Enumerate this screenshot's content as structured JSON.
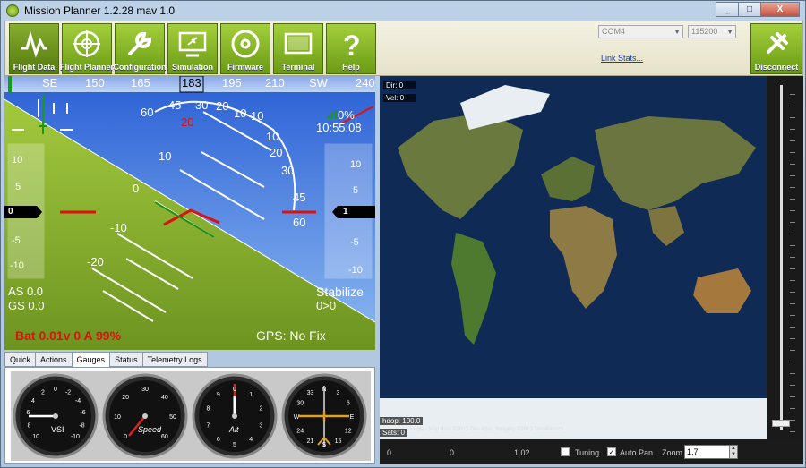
{
  "window": {
    "title": "Mission Planner 1.2.28 mav 1.0",
    "min": "_",
    "max": "□",
    "close": "X"
  },
  "nav": [
    {
      "label": "Flight Data",
      "icon": "pulse-icon"
    },
    {
      "label": "Flight Planner",
      "icon": "globe-icon"
    },
    {
      "label": "Configuration",
      "icon": "wrench-icon"
    },
    {
      "label": "Simulation",
      "icon": "monitor-plane-icon"
    },
    {
      "label": "Firmware",
      "icon": "disc-icon"
    },
    {
      "label": "Terminal",
      "icon": "terminal-icon"
    },
    {
      "label": "Help",
      "icon": "question-icon"
    }
  ],
  "connection": {
    "port": "COM4",
    "baud": "115200",
    "link_stats": "Link Stats...",
    "disconnect_label": "Disconnect"
  },
  "hud": {
    "heading_labels": [
      "SE",
      "150",
      "165",
      "183",
      "195",
      "210",
      "SW",
      "240"
    ],
    "airspeed": "AS 0.0",
    "groundspeed": "GS 0.0",
    "speed_readout": "0",
    "alt_readout": "1",
    "speed_ticks": [
      "10",
      "5",
      "0",
      "-5",
      "-10"
    ],
    "alt_ticks": [
      "10",
      "5",
      "0",
      "-5",
      "-10"
    ],
    "roll_labels_left": [
      "60",
      "45",
      "30",
      "20"
    ],
    "roll_labels_right": [
      "20",
      "30",
      "45",
      "60"
    ],
    "roll_center": "10",
    "roll_left_ten": "10",
    "pitch_labels_left": [
      "20",
      "10",
      "0",
      "-10",
      "-20"
    ],
    "pitch_labels_right": [
      "0",
      "10",
      "20",
      "30"
    ],
    "link_percent": "0%",
    "time": "10:55:08",
    "mode": "Stabilize",
    "wp": "0>0",
    "battery": "Bat 0.01v 0 A 99%",
    "gps": "GPS: No Fix"
  },
  "tabs": [
    "Quick",
    "Actions",
    "Gauges",
    "Status",
    "Telemetry Logs"
  ],
  "active_tab": "Gauges",
  "gauges": [
    {
      "label": "VSI",
      "ticks": [
        "10",
        "8",
        "6",
        "4",
        "2",
        "0",
        "-2",
        "-4",
        "-6",
        "-8",
        "-10"
      ]
    },
    {
      "label": "Speed",
      "ticks": [
        "0",
        "10",
        "20",
        "30",
        "40",
        "50",
        "60"
      ]
    },
    {
      "label": "Alt",
      "ticks": [
        "0",
        "1",
        "2",
        "3",
        "4",
        "5",
        "6",
        "7",
        "8",
        "9"
      ]
    },
    {
      "label": "",
      "ticks": [
        "N",
        "3",
        "6",
        "E",
        "12",
        "15",
        "S",
        "21",
        "24",
        "W",
        "30",
        "33"
      ]
    }
  ],
  "map": {
    "dir": "Dir: 0",
    "vel": "Vel: 0",
    "hdop": "hdop: 100.0",
    "sats": "Sats: 0",
    "copyright": "Google - Map data ©2013 Tele Atlas, Imagery ©2013 TerraMetrics"
  },
  "bottom": {
    "v1": "0",
    "v2": "0",
    "v3": "1.02",
    "tuning_label": "Tuning",
    "autopan_label": "Auto Pan",
    "zoom_label": "Zoom",
    "zoom_value": "1.7",
    "tuning_checked": "",
    "autopan_checked": "✓"
  },
  "colors": {
    "sky": "#2b6fd6",
    "ground": "#8fb838",
    "accent_green": "#7fb11c",
    "hud_red": "#e01010"
  }
}
